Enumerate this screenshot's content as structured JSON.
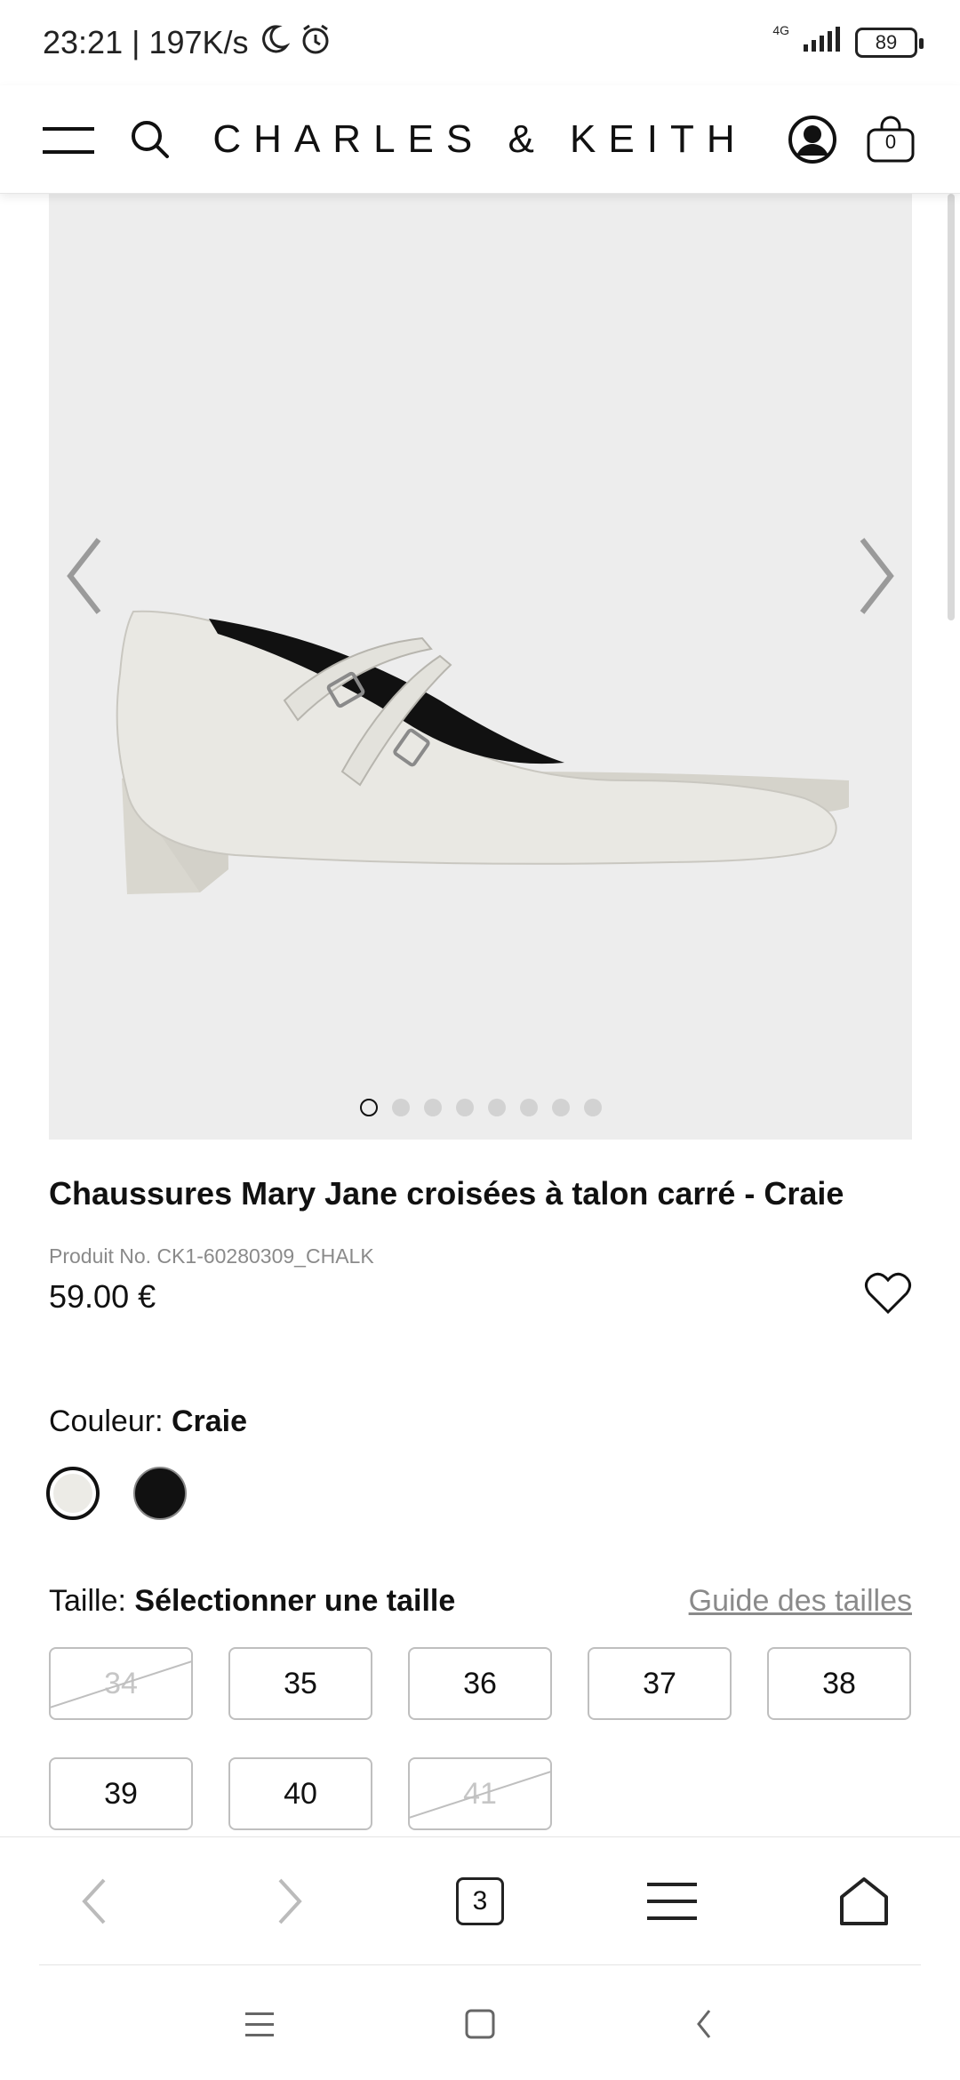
{
  "status_bar": {
    "time_speed": "23:21 | 197K/s",
    "network": "4G",
    "battery": "89"
  },
  "header": {
    "brand": "CHARLES & KEITH",
    "cart_count": "0"
  },
  "gallery": {
    "image_count": 8,
    "active_index": 0
  },
  "product": {
    "title": "Chaussures Mary Jane croisées à talon carré - Craie",
    "sku": "Produit No. CK1-60280309_CHALK",
    "price": "59.00 €"
  },
  "color": {
    "label": "Couleur:",
    "selected": "Craie",
    "swatches": [
      {
        "name": "Craie",
        "hex": "#ecebe6"
      },
      {
        "name": "Noir",
        "hex": "#111111"
      }
    ]
  },
  "size": {
    "label": "Taille:",
    "prompt": "Sélectionner une taille",
    "guide": "Guide des tailles",
    "options": [
      {
        "label": "34",
        "available": false
      },
      {
        "label": "35",
        "available": true
      },
      {
        "label": "36",
        "available": true
      },
      {
        "label": "37",
        "available": true
      },
      {
        "label": "38",
        "available": true
      },
      {
        "label": "39",
        "available": true
      },
      {
        "label": "40",
        "available": true
      },
      {
        "label": "41",
        "available": false
      }
    ]
  },
  "browser_bar": {
    "tab_count": "3"
  }
}
